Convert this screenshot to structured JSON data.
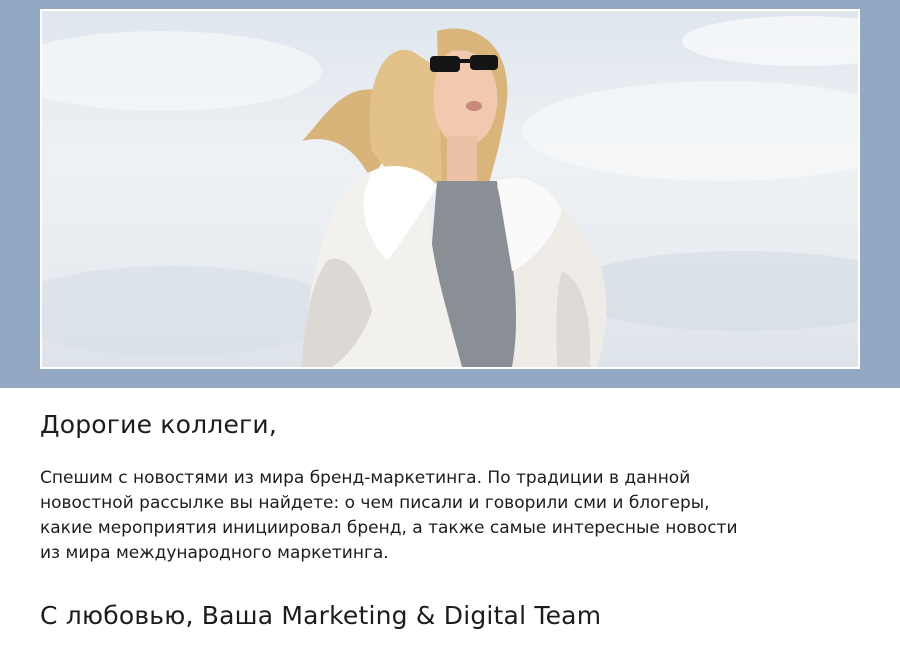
{
  "hero": {
    "image": "woman-in-white-fur-coat-and-sunglasses-against-sky",
    "band_color": "#93a8c3"
  },
  "letter": {
    "greeting": "Дорогие коллеги,",
    "intro_lines": [
      "Спешим с новостями из мира бренд-маркетинга. По традиции в данной",
      "новостной рассылке вы найдете: о чем писали и говорили сми и блогеры,",
      "какие мероприятия инициировал бренд, а также самые интересные новости",
      "из мира международного маркетинга."
    ],
    "signature": "С любовью, Ваша Marketing & Digital Team"
  }
}
